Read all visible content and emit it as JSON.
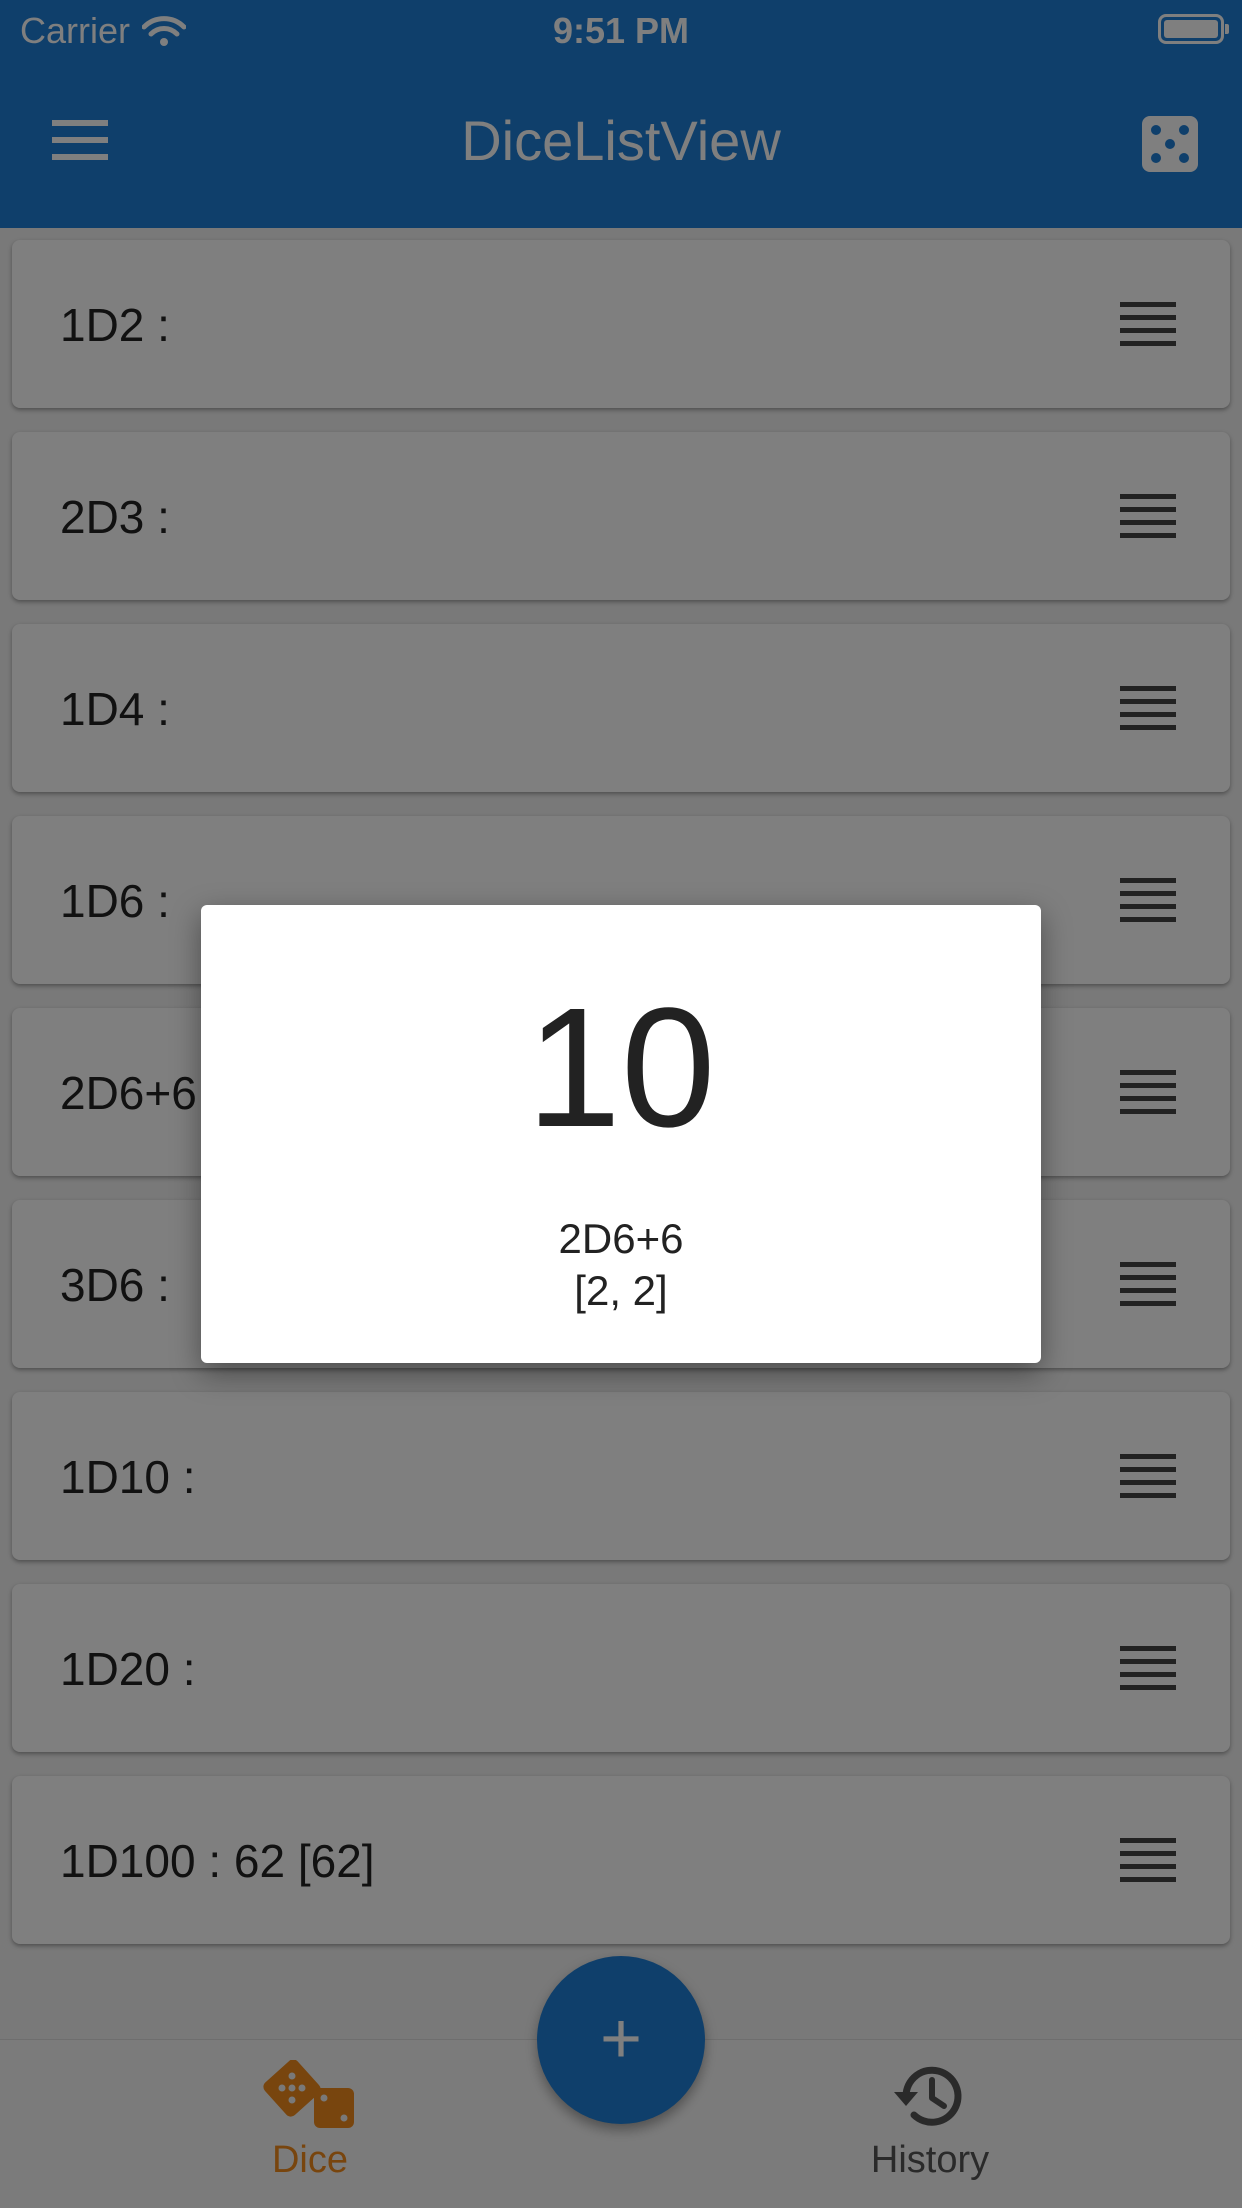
{
  "status_bar": {
    "carrier": "Carrier",
    "time": "9:51 PM"
  },
  "app_bar": {
    "title": "DiceListView",
    "menu_icon": "hamburger-menu-icon",
    "action_icon": "dice-icon"
  },
  "dice_list": {
    "items": [
      {
        "label": "1D2 :"
      },
      {
        "label": "2D3 :"
      },
      {
        "label": "1D4 :"
      },
      {
        "label": "1D6 :"
      },
      {
        "label": "2D6+6 :"
      },
      {
        "label": "3D6 :"
      },
      {
        "label": "1D10 :"
      },
      {
        "label": "1D20 :"
      },
      {
        "label": "1D100 : 62 [62]"
      }
    ],
    "handle_icon": "drag-handle-icon"
  },
  "fab": {
    "label": "+"
  },
  "bottom_nav": {
    "dice_label": "Dice",
    "history_label": "History",
    "active": "Dice"
  },
  "dialog": {
    "total": "10",
    "formula": "2D6+6",
    "rolls": "[2, 2]"
  },
  "colors": {
    "primary": "#1e7fd6",
    "accent": "#f08a1c",
    "text": "#222222",
    "inactive": "#555555"
  }
}
